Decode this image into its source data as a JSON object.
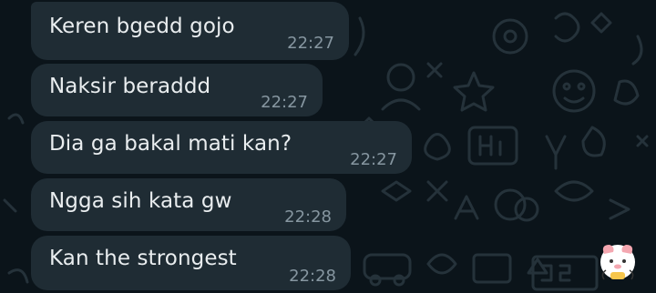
{
  "messages": [
    {
      "text": "Keren bgedd gojo",
      "time": "22:27"
    },
    {
      "text": "Naksir beraddd",
      "time": "22:27"
    },
    {
      "text": "Dia ga bakal mati kan?",
      "time": "22:27"
    },
    {
      "text": "Ngga sih kata gw",
      "time": "22:28"
    },
    {
      "text": "Kan the strongest",
      "time": "22:28"
    }
  ],
  "colors": {
    "background": "#0b141a",
    "bubble": "#1f2c34",
    "text": "#e9edef",
    "timestamp": "#8696a0",
    "doodle": "#25323a"
  },
  "icons": [
    "chat-wallpaper-doodles",
    "sticker-icon"
  ]
}
